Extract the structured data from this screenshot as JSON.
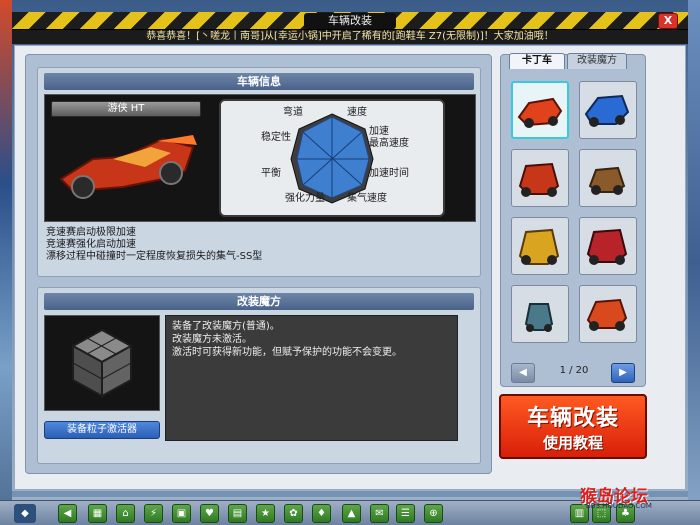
{
  "window": {
    "title": "车辆改装",
    "close_label": "X",
    "announcement": "恭喜恭喜！[丶嗟龙丨南哥]从[幸运小锅]中开启了稀有的[跑鞋车 Z7(无限制)]！大家加油哦！"
  },
  "car_info": {
    "section_title": "车辆信息",
    "car_name": "游侠 HT",
    "stats": [
      "弯道",
      "速度",
      "加速",
      "最高速度",
      "稳定性",
      "平衡",
      "加速时间",
      "强化力量",
      "集气速度"
    ],
    "description": [
      "竞速赛启动极限加速",
      "竞速赛强化启动加速",
      "漂移过程中碰撞时一定程度恢复损失的集气-SS型"
    ]
  },
  "magic": {
    "section_title": "改装魔方",
    "equip_button": "装备粒子激活器",
    "text_lines": [
      "装备了改装魔方(普通)。",
      "改装魔方未激活。",
      "激活时可获得新功能，但赋予保护的功能不会变更。"
    ]
  },
  "side": {
    "tabs": [
      "卡丁车",
      "改装魔方"
    ],
    "cars": [
      {
        "name": "car-1",
        "color": "#e0431c"
      },
      {
        "name": "car-2",
        "color": "#2a6ad4"
      },
      {
        "name": "car-3",
        "color": "#c8361a"
      },
      {
        "name": "car-4",
        "color": "#8a5a2a"
      },
      {
        "name": "car-5",
        "color": "#d9a520"
      },
      {
        "name": "car-6",
        "color": "#b8232a"
      },
      {
        "name": "car-7",
        "color": "#4a7a8a"
      },
      {
        "name": "car-8",
        "color": "#d84a1e"
      }
    ],
    "page_text": "1 / 20",
    "prev_label": "◀",
    "next_label": "▶"
  },
  "tutorial": {
    "line1": "车辆改装",
    "line2": "使用教程"
  },
  "taskbar": {
    "icons": [
      "◀",
      "▦",
      "⌂",
      "⚡",
      "▣",
      "♥",
      "▤",
      "★",
      "✿",
      "♦",
      "▲",
      "✉",
      "☰",
      "⊕",
      "▥",
      "⬚",
      "♣"
    ]
  },
  "watermark": {
    "line1": "猴岛论坛",
    "line2": "BBS.HOUDAO.COM"
  },
  "colors": {
    "accent": "#2d63b8",
    "tutorial": "#e0361a",
    "hazard": "#e4c21a"
  }
}
